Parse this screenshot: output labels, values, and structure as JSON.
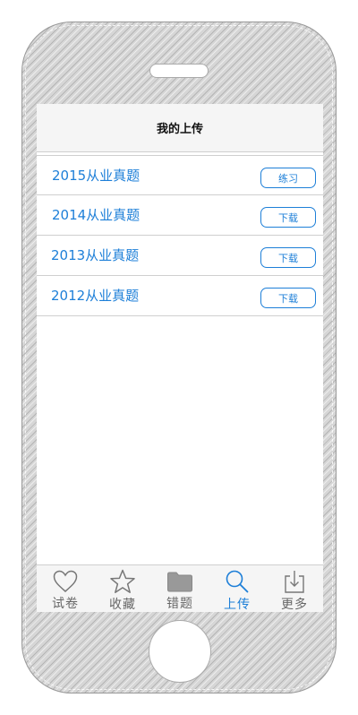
{
  "header": {
    "title": "我的上传"
  },
  "list": [
    {
      "title": "2015从业真题",
      "action": "练习"
    },
    {
      "title": "2014从业真题",
      "action": "下载"
    },
    {
      "title": "2013从业真题",
      "action": "下载"
    },
    {
      "title": "2012从业真题",
      "action": "下载"
    }
  ],
  "tabbar": {
    "active_index": 3,
    "items": [
      {
        "label": "试卷",
        "icon": "heart-icon"
      },
      {
        "label": "收藏",
        "icon": "star-icon"
      },
      {
        "label": "错题",
        "icon": "folder-icon"
      },
      {
        "label": "上传",
        "icon": "search-icon"
      },
      {
        "label": "更多",
        "icon": "download-icon"
      }
    ]
  },
  "colors": {
    "accent": "#1d7fd8",
    "tab_inactive": "#666666",
    "bar_background": "#f5f5f5"
  }
}
